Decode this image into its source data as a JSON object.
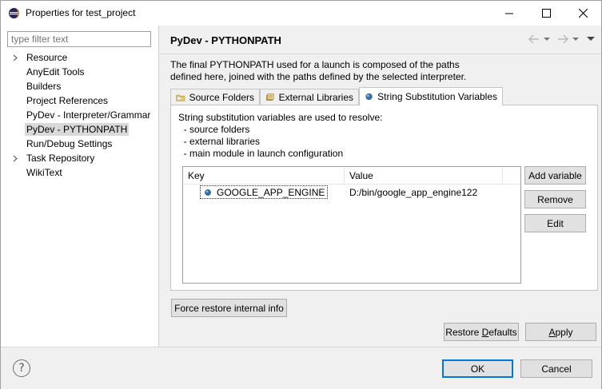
{
  "window": {
    "title": "Properties for test_project",
    "icon": "eclipse-icon"
  },
  "filter": {
    "placeholder": "type filter text"
  },
  "tree": {
    "items": [
      {
        "label": "Resource",
        "expandable": true
      },
      {
        "label": "AnyEdit Tools",
        "expandable": false
      },
      {
        "label": "Builders",
        "expandable": false
      },
      {
        "label": "Project References",
        "expandable": false
      },
      {
        "label": "PyDev - Interpreter/Grammar",
        "expandable": false
      },
      {
        "label": "PyDev - PYTHONPATH",
        "expandable": false,
        "selected": true
      },
      {
        "label": "Run/Debug Settings",
        "expandable": false
      },
      {
        "label": "Task Repository",
        "expandable": true
      },
      {
        "label": "WikiText",
        "expandable": false
      }
    ]
  },
  "page": {
    "title": "PyDev - PYTHONPATH",
    "description_line1": "The final PYTHONPATH used for a launch is composed of the paths",
    "description_line2": "defined here, joined with the paths defined by the selected interpreter."
  },
  "tabs": [
    {
      "label": "Source Folders",
      "icon": "source-folder-icon"
    },
    {
      "label": "External Libraries",
      "icon": "library-icon"
    },
    {
      "label": "String Substitution Variables",
      "icon": "variable-icon",
      "active": true
    }
  ],
  "panel": {
    "line1": "String substitution variables are used to resolve:",
    "line2": "  - source folders",
    "line3": "  - external libraries",
    "line4": "  - main module in launch configuration"
  },
  "table": {
    "headers": {
      "key": "Key",
      "value": "Value"
    },
    "rows": [
      {
        "key": "GOOGLE_APP_ENGINE",
        "value": "D:/bin/google_app_engine122"
      }
    ]
  },
  "buttons": {
    "add_variable": "Add variable",
    "remove": "Remove",
    "edit": "Edit",
    "force_restore": "Force restore internal info",
    "restore_defaults_pre": "Restore ",
    "restore_defaults_ul": "D",
    "restore_defaults_post": "efaults",
    "apply_pre": "",
    "apply_ul": "A",
    "apply_post": "pply",
    "ok": "OK",
    "cancel": "Cancel",
    "help": "?"
  },
  "colors": {
    "accent": "#0078d7",
    "selection": "#d9d9d9",
    "variable_icon": "#3a6ea5"
  }
}
